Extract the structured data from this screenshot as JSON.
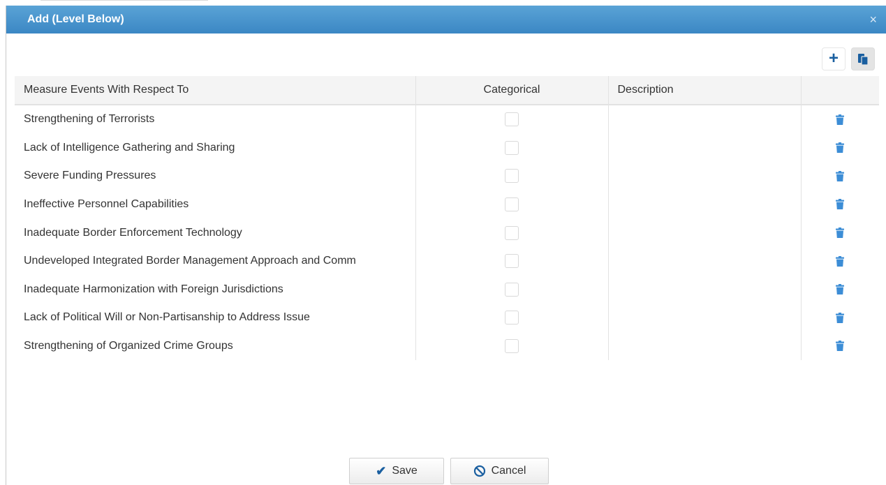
{
  "dialog": {
    "title": "Add (Level Below)",
    "close_glyph": "×"
  },
  "toolbar": {
    "add_icon": "plus-icon",
    "paste_icon": "paste-icon"
  },
  "table": {
    "columns": [
      "Measure Events With Respect To",
      "Categorical",
      "Description",
      ""
    ],
    "rows": [
      {
        "event": "Strengthening of Terrorists",
        "categorical": false,
        "description": ""
      },
      {
        "event": "Lack of Intelligence Gathering and Sharing",
        "categorical": false,
        "description": ""
      },
      {
        "event": "Severe Funding Pressures",
        "categorical": false,
        "description": ""
      },
      {
        "event": "Ineffective Personnel Capabilities",
        "categorical": false,
        "description": ""
      },
      {
        "event": "Inadequate Border Enforcement Technology",
        "categorical": false,
        "description": ""
      },
      {
        "event": "Undeveloped Integrated Border Management Approach and Comm",
        "categorical": false,
        "description": ""
      },
      {
        "event": "Inadequate Harmonization with Foreign Jurisdictions",
        "categorical": false,
        "description": ""
      },
      {
        "event": "Lack of Political Will or Non-Partisanship to Address Issue",
        "categorical": false,
        "description": ""
      },
      {
        "event": "Strengthening of Organized Crime Groups",
        "categorical": false,
        "description": ""
      }
    ]
  },
  "footer": {
    "save_label": "Save",
    "cancel_label": "Cancel"
  },
  "colors": {
    "title_bar": "#3b87c4",
    "icon_blue": "#3c8dd6",
    "accent_dark": "#1a5fa0"
  }
}
